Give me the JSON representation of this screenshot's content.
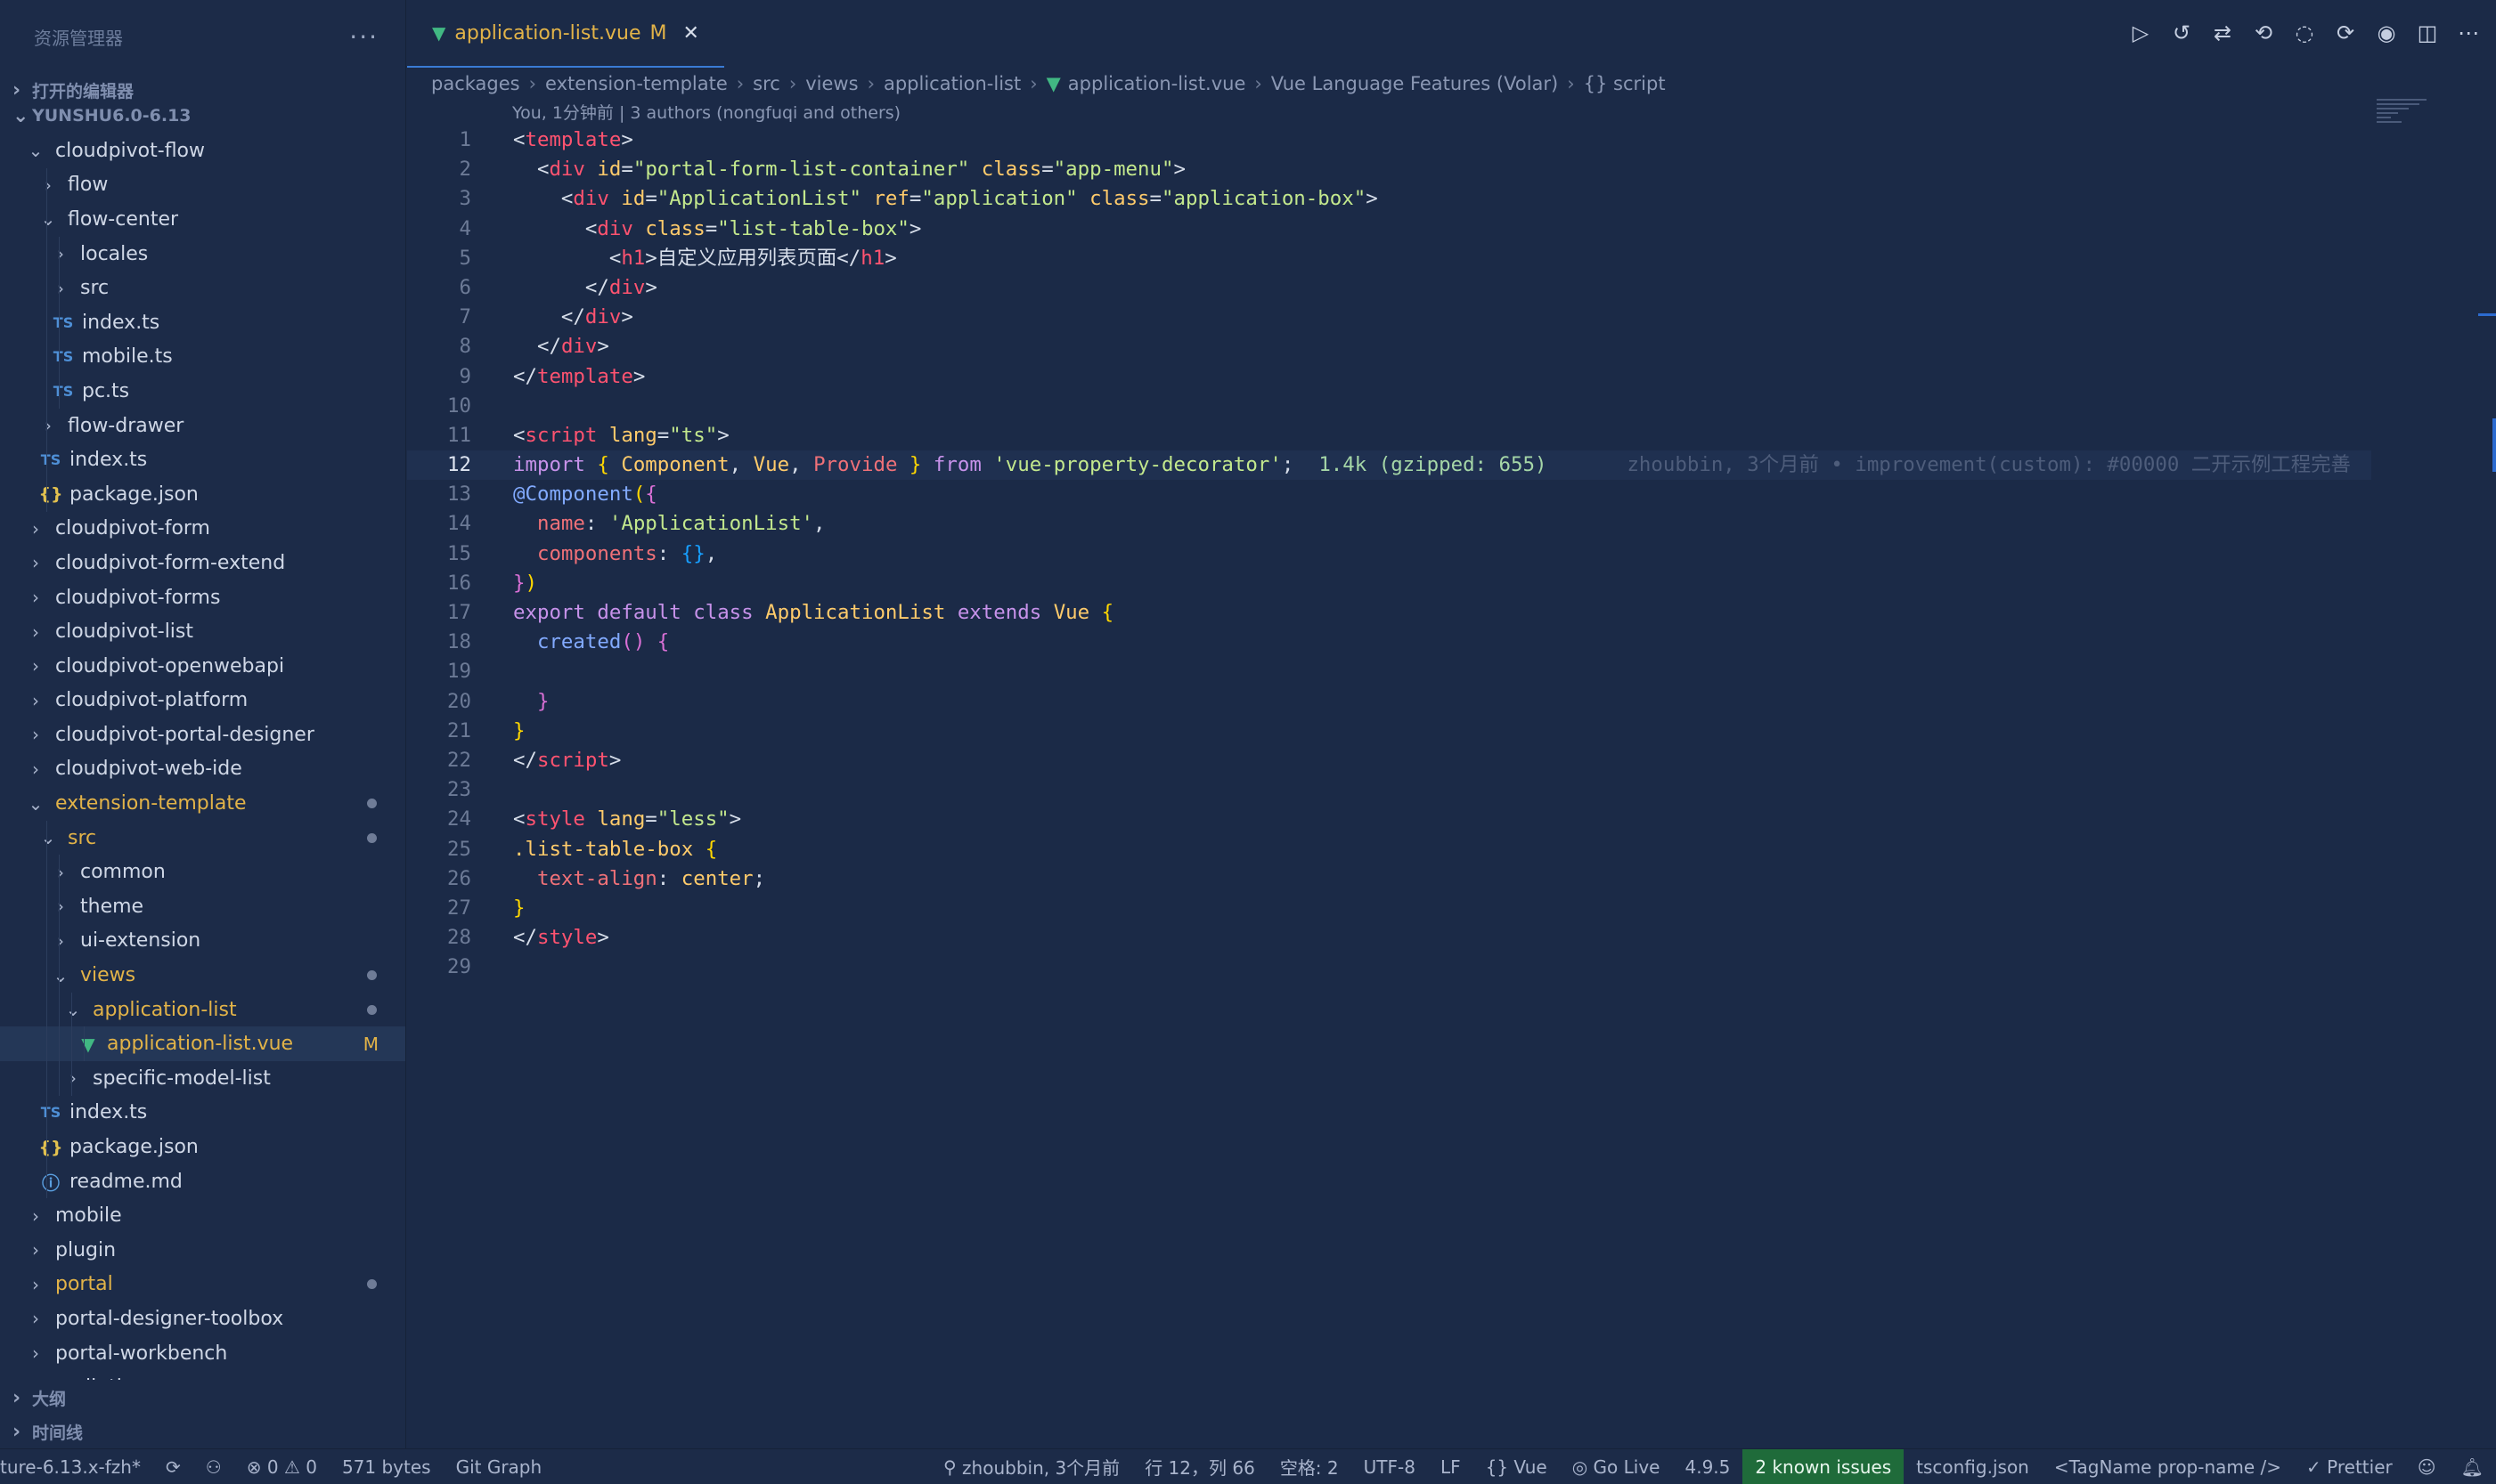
{
  "sidebar": {
    "title": "资源管理器",
    "more": "···",
    "open_editors": "打开的编辑器",
    "workspace": "YUNSHU6.0-6.13",
    "outline": "大纲",
    "timeline": "时间线",
    "tree": [
      {
        "label": "cloudpivot-flow",
        "type": "folder",
        "open": true,
        "depth": 1
      },
      {
        "label": "flow",
        "type": "folder",
        "open": false,
        "depth": 2
      },
      {
        "label": "flow-center",
        "type": "folder",
        "open": true,
        "depth": 2
      },
      {
        "label": "locales",
        "type": "folder",
        "open": false,
        "depth": 3
      },
      {
        "label": "src",
        "type": "folder",
        "open": false,
        "depth": 3
      },
      {
        "label": "index.ts",
        "type": "ts",
        "depth": 3
      },
      {
        "label": "mobile.ts",
        "type": "ts",
        "depth": 3
      },
      {
        "label": "pc.ts",
        "type": "ts",
        "depth": 3
      },
      {
        "label": "flow-drawer",
        "type": "folder",
        "open": false,
        "depth": 2
      },
      {
        "label": "index.ts",
        "type": "ts",
        "depth": 2
      },
      {
        "label": "package.json",
        "type": "json",
        "depth": 2
      },
      {
        "label": "cloudpivot-form",
        "type": "folder",
        "open": false,
        "depth": 1
      },
      {
        "label": "cloudpivot-form-extend",
        "type": "folder",
        "open": false,
        "depth": 1
      },
      {
        "label": "cloudpivot-forms",
        "type": "folder",
        "open": false,
        "depth": 1
      },
      {
        "label": "cloudpivot-list",
        "type": "folder",
        "open": false,
        "depth": 1
      },
      {
        "label": "cloudpivot-openwebapi",
        "type": "folder",
        "open": false,
        "depth": 1
      },
      {
        "label": "cloudpivot-platform",
        "type": "folder",
        "open": false,
        "depth": 1
      },
      {
        "label": "cloudpivot-portal-designer",
        "type": "folder",
        "open": false,
        "depth": 1
      },
      {
        "label": "cloudpivot-web-ide",
        "type": "folder",
        "open": false,
        "depth": 1
      },
      {
        "label": "extension-template",
        "type": "folder",
        "open": true,
        "depth": 1,
        "modified": true,
        "dot": true
      },
      {
        "label": "src",
        "type": "folder",
        "open": true,
        "depth": 2,
        "modified": true,
        "dot": true
      },
      {
        "label": "common",
        "type": "folder",
        "open": false,
        "depth": 3
      },
      {
        "label": "theme",
        "type": "folder",
        "open": false,
        "depth": 3
      },
      {
        "label": "ui-extension",
        "type": "folder",
        "open": false,
        "depth": 3
      },
      {
        "label": "views",
        "type": "folder",
        "open": true,
        "depth": 3,
        "modified": true,
        "dot": true
      },
      {
        "label": "application-list",
        "type": "folder",
        "open": true,
        "depth": 4,
        "modified": true,
        "dot": true
      },
      {
        "label": "application-list.vue",
        "type": "vue",
        "depth": 5,
        "modified": true,
        "selected": true,
        "badge": "M"
      },
      {
        "label": "specific-model-list",
        "type": "folder",
        "open": false,
        "depth": 4
      },
      {
        "label": "index.ts",
        "type": "ts",
        "depth": 2
      },
      {
        "label": "package.json",
        "type": "json",
        "depth": 2
      },
      {
        "label": "readme.md",
        "type": "info",
        "depth": 2
      },
      {
        "label": "mobile",
        "type": "folder",
        "open": false,
        "depth": 1
      },
      {
        "label": "plugin",
        "type": "folder",
        "open": false,
        "depth": 1
      },
      {
        "label": "portal",
        "type": "folder",
        "open": false,
        "depth": 1,
        "modified": true,
        "dot": true
      },
      {
        "label": "portal-designer-toolbox",
        "type": "folder",
        "open": false,
        "depth": 1
      },
      {
        "label": "portal-workbench",
        "type": "folder",
        "open": false,
        "depth": 1
      },
      {
        "label": ".eslintignore",
        "type": "eslint",
        "depth": 1
      }
    ]
  },
  "editor": {
    "tab": {
      "label": "application-list.vue",
      "flag": "M",
      "close": "✕"
    },
    "breadcrumb": [
      "packages",
      "extension-template",
      "src",
      "views",
      "application-list",
      "application-list.vue",
      "Vue Language Features (Volar)",
      "{} script"
    ],
    "codelens": "You, 1分钟前 | 3 authors (nongfuqi and others)",
    "current_line": 12,
    "inline_hint": "1.4k (gzipped: 655)",
    "blame": "zhoubbin, 3个月前 • improvement(custom): #00000 二开示例工程完善"
  },
  "statusbar": {
    "branch": "ture-6.13.x-fzh*",
    "errors": "0",
    "warnings": "0",
    "size": "571 bytes",
    "git_graph": "Git Graph",
    "blame": "zhoubbin, 3个月前",
    "position": "行 12，列 66",
    "spaces": "空格: 2",
    "encoding": "UTF-8",
    "eol": "LF",
    "language": "Vue",
    "golive": "Go Live",
    "version": "4.9.5",
    "issues": "2 known issues",
    "tsconfig": "tsconfig.json",
    "tagname": "<TagName prop-name />",
    "prettier": "Prettier"
  }
}
